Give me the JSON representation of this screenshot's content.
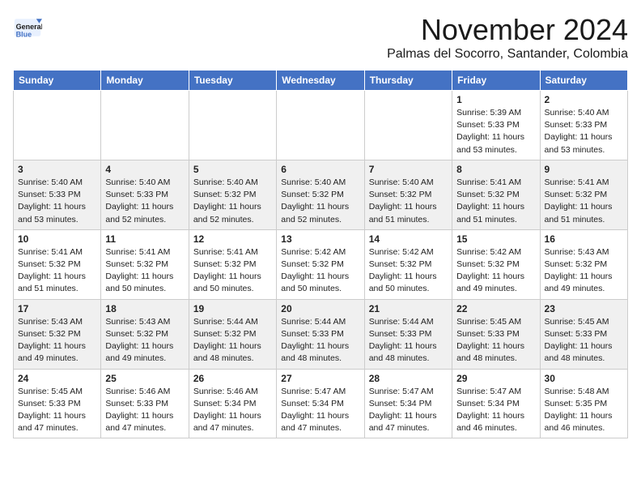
{
  "header": {
    "logo": {
      "line1": "General",
      "line2": "Blue"
    },
    "title": "November 2024",
    "location": "Palmas del Socorro, Santander, Colombia"
  },
  "weekdays": [
    "Sunday",
    "Monday",
    "Tuesday",
    "Wednesday",
    "Thursday",
    "Friday",
    "Saturday"
  ],
  "weeks": [
    [
      {
        "day": "",
        "info": ""
      },
      {
        "day": "",
        "info": ""
      },
      {
        "day": "",
        "info": ""
      },
      {
        "day": "",
        "info": ""
      },
      {
        "day": "",
        "info": ""
      },
      {
        "day": "1",
        "info": "Sunrise: 5:39 AM\nSunset: 5:33 PM\nDaylight: 11 hours and 53 minutes."
      },
      {
        "day": "2",
        "info": "Sunrise: 5:40 AM\nSunset: 5:33 PM\nDaylight: 11 hours and 53 minutes."
      }
    ],
    [
      {
        "day": "3",
        "info": "Sunrise: 5:40 AM\nSunset: 5:33 PM\nDaylight: 11 hours and 53 minutes."
      },
      {
        "day": "4",
        "info": "Sunrise: 5:40 AM\nSunset: 5:33 PM\nDaylight: 11 hours and 52 minutes."
      },
      {
        "day": "5",
        "info": "Sunrise: 5:40 AM\nSunset: 5:32 PM\nDaylight: 11 hours and 52 minutes."
      },
      {
        "day": "6",
        "info": "Sunrise: 5:40 AM\nSunset: 5:32 PM\nDaylight: 11 hours and 52 minutes."
      },
      {
        "day": "7",
        "info": "Sunrise: 5:40 AM\nSunset: 5:32 PM\nDaylight: 11 hours and 51 minutes."
      },
      {
        "day": "8",
        "info": "Sunrise: 5:41 AM\nSunset: 5:32 PM\nDaylight: 11 hours and 51 minutes."
      },
      {
        "day": "9",
        "info": "Sunrise: 5:41 AM\nSunset: 5:32 PM\nDaylight: 11 hours and 51 minutes."
      }
    ],
    [
      {
        "day": "10",
        "info": "Sunrise: 5:41 AM\nSunset: 5:32 PM\nDaylight: 11 hours and 51 minutes."
      },
      {
        "day": "11",
        "info": "Sunrise: 5:41 AM\nSunset: 5:32 PM\nDaylight: 11 hours and 50 minutes."
      },
      {
        "day": "12",
        "info": "Sunrise: 5:41 AM\nSunset: 5:32 PM\nDaylight: 11 hours and 50 minutes."
      },
      {
        "day": "13",
        "info": "Sunrise: 5:42 AM\nSunset: 5:32 PM\nDaylight: 11 hours and 50 minutes."
      },
      {
        "day": "14",
        "info": "Sunrise: 5:42 AM\nSunset: 5:32 PM\nDaylight: 11 hours and 50 minutes."
      },
      {
        "day": "15",
        "info": "Sunrise: 5:42 AM\nSunset: 5:32 PM\nDaylight: 11 hours and 49 minutes."
      },
      {
        "day": "16",
        "info": "Sunrise: 5:43 AM\nSunset: 5:32 PM\nDaylight: 11 hours and 49 minutes."
      }
    ],
    [
      {
        "day": "17",
        "info": "Sunrise: 5:43 AM\nSunset: 5:32 PM\nDaylight: 11 hours and 49 minutes."
      },
      {
        "day": "18",
        "info": "Sunrise: 5:43 AM\nSunset: 5:32 PM\nDaylight: 11 hours and 49 minutes."
      },
      {
        "day": "19",
        "info": "Sunrise: 5:44 AM\nSunset: 5:32 PM\nDaylight: 11 hours and 48 minutes."
      },
      {
        "day": "20",
        "info": "Sunrise: 5:44 AM\nSunset: 5:33 PM\nDaylight: 11 hours and 48 minutes."
      },
      {
        "day": "21",
        "info": "Sunrise: 5:44 AM\nSunset: 5:33 PM\nDaylight: 11 hours and 48 minutes."
      },
      {
        "day": "22",
        "info": "Sunrise: 5:45 AM\nSunset: 5:33 PM\nDaylight: 11 hours and 48 minutes."
      },
      {
        "day": "23",
        "info": "Sunrise: 5:45 AM\nSunset: 5:33 PM\nDaylight: 11 hours and 48 minutes."
      }
    ],
    [
      {
        "day": "24",
        "info": "Sunrise: 5:45 AM\nSunset: 5:33 PM\nDaylight: 11 hours and 47 minutes."
      },
      {
        "day": "25",
        "info": "Sunrise: 5:46 AM\nSunset: 5:33 PM\nDaylight: 11 hours and 47 minutes."
      },
      {
        "day": "26",
        "info": "Sunrise: 5:46 AM\nSunset: 5:34 PM\nDaylight: 11 hours and 47 minutes."
      },
      {
        "day": "27",
        "info": "Sunrise: 5:47 AM\nSunset: 5:34 PM\nDaylight: 11 hours and 47 minutes."
      },
      {
        "day": "28",
        "info": "Sunrise: 5:47 AM\nSunset: 5:34 PM\nDaylight: 11 hours and 47 minutes."
      },
      {
        "day": "29",
        "info": "Sunrise: 5:47 AM\nSunset: 5:34 PM\nDaylight: 11 hours and 46 minutes."
      },
      {
        "day": "30",
        "info": "Sunrise: 5:48 AM\nSunset: 5:35 PM\nDaylight: 11 hours and 46 minutes."
      }
    ]
  ]
}
